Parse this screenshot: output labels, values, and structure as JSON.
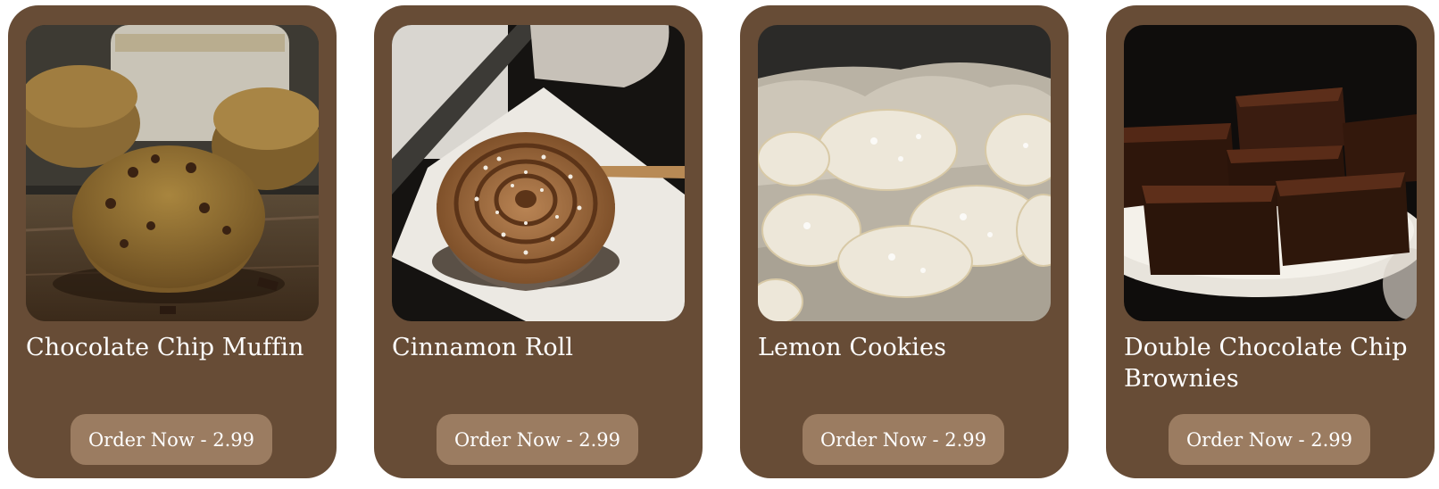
{
  "products": [
    {
      "name": "Chocolate Chip Muffin",
      "button_label": "Order Now - 2.99",
      "image_icon": "muffin-photo"
    },
    {
      "name": "Cinnamon Roll",
      "button_label": "Order Now - 2.99",
      "image_icon": "cinnamon-roll-photo"
    },
    {
      "name": "Lemon Cookies",
      "button_label": "Order Now - 2.99",
      "image_icon": "lemon-cookies-photo"
    },
    {
      "name": "Double Chocolate Chip Brownies",
      "button_label": "Order Now - 2.99",
      "image_icon": "brownies-photo"
    }
  ],
  "colors": {
    "card_background": "#674c36",
    "button_background": "#9b7c61",
    "text": "#ffffff"
  }
}
